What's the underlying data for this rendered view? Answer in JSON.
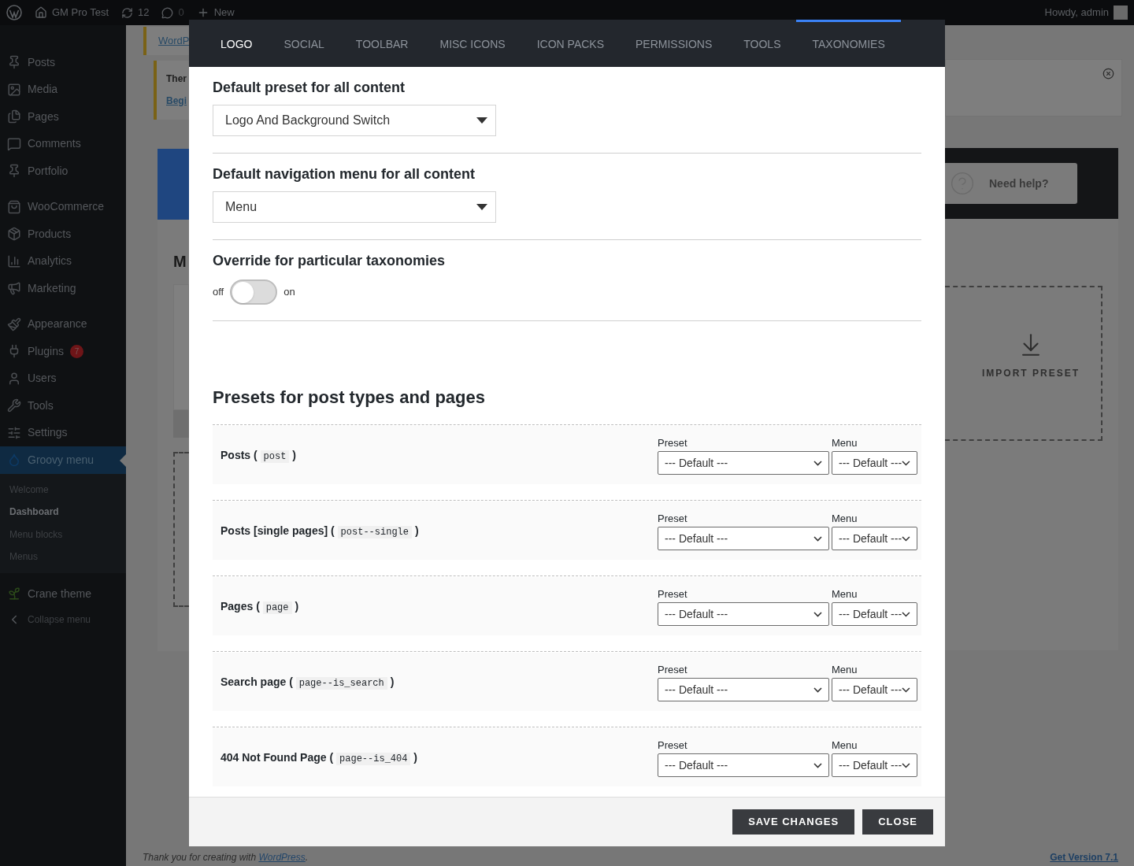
{
  "admin_bar": {
    "site": "GM Pro Test",
    "updates": "12",
    "comments": "0",
    "new": "New",
    "greeting": "Howdy, admin"
  },
  "sidebar": {
    "items": [
      {
        "label": "Posts",
        "selected": false
      },
      {
        "label": "Media",
        "selected": false
      },
      {
        "label": "Pages",
        "selected": false
      },
      {
        "label": "Comments",
        "selected": false
      },
      {
        "label": "Portfolio",
        "selected": false
      },
      {
        "label": "WooCommerce",
        "selected": false
      },
      {
        "label": "Products",
        "selected": false
      },
      {
        "label": "Analytics",
        "selected": false
      },
      {
        "label": "Marketing",
        "selected": false
      },
      {
        "label": "Appearance",
        "selected": false
      },
      {
        "label": "Plugins",
        "selected": false,
        "badge": "7"
      },
      {
        "label": "Users",
        "selected": false
      },
      {
        "label": "Tools",
        "selected": false
      },
      {
        "label": "Settings",
        "selected": false
      },
      {
        "label": "Groovy menu",
        "selected": true
      }
    ],
    "submenu": [
      {
        "label": "Welcome",
        "selected": false
      },
      {
        "label": "Dashboard",
        "selected": true
      },
      {
        "label": "Menu blocks",
        "selected": false
      },
      {
        "label": "Menus",
        "selected": false
      }
    ],
    "extra": [
      {
        "label": "Crane theme"
      },
      {
        "label": "Collapse menu"
      }
    ]
  },
  "background": {
    "notice_link": "WordP",
    "notice_title": "Ther",
    "notice_link_2": "Begi",
    "card_heading": "M",
    "help_button": "Need help?",
    "import_label": "IMPORT PRESET",
    "footer_text": "Thank you for creating with",
    "footer_link": "WordPress",
    "footer_end": ".",
    "version_link": "Get Version 7.1"
  },
  "modal": {
    "tabs": [
      {
        "label": "LOGO",
        "selected": true,
        "highlighted": false
      },
      {
        "label": "SOCIAL",
        "selected": false,
        "highlighted": false
      },
      {
        "label": "TOOLBAR",
        "selected": false,
        "highlighted": false
      },
      {
        "label": "MISC ICONS",
        "selected": false,
        "highlighted": false
      },
      {
        "label": "ICON PACKS",
        "selected": false,
        "highlighted": false
      },
      {
        "label": "PERMISSIONS",
        "selected": false,
        "highlighted": false
      },
      {
        "label": "TOOLS",
        "selected": false,
        "highlighted": false
      },
      {
        "label": "TAXONOMIES",
        "selected": false,
        "highlighted": true
      }
    ],
    "default_preset": {
      "label": "Default preset for all content",
      "value": "Logo And Background Switch"
    },
    "default_menu": {
      "label": "Default navigation menu for all content",
      "value": "Menu"
    },
    "override": {
      "label": "Override for particular taxonomies",
      "off_label": "off",
      "on_label": "on",
      "on": false
    },
    "presets_heading": "Presets for post types and pages",
    "rows": [
      {
        "name": "Posts",
        "open": "(",
        "slug": "post",
        "close": ")",
        "preset_label": "Preset",
        "preset": "--- Default ---",
        "menu_label": "Menu",
        "menu": "--- Default ---"
      },
      {
        "name": "Posts [single pages]",
        "open": "(",
        "slug": "post--single",
        "close": ")",
        "preset_label": "Preset",
        "preset": "--- Default ---",
        "menu_label": "Menu",
        "menu": "--- Default ---"
      },
      {
        "name": "Pages",
        "open": "(",
        "slug": "page",
        "close": ")",
        "preset_label": "Preset",
        "preset": "--- Default ---",
        "menu_label": "Menu",
        "menu": "--- Default ---"
      },
      {
        "name": "Search page",
        "open": "(",
        "slug": "page--is_search",
        "close": ")",
        "preset_label": "Preset",
        "preset": "--- Default ---",
        "menu_label": "Menu",
        "menu": "--- Default ---"
      },
      {
        "name": "404 Not Found Page",
        "open": "(",
        "slug": "page--is_404",
        "close": ")",
        "preset_label": "Preset",
        "preset": "--- Default ---",
        "menu_label": "Menu",
        "menu": "--- Default ---"
      }
    ],
    "buttons": [
      {
        "label": "SAVE CHANGES"
      },
      {
        "label": "CLOSE"
      }
    ]
  }
}
